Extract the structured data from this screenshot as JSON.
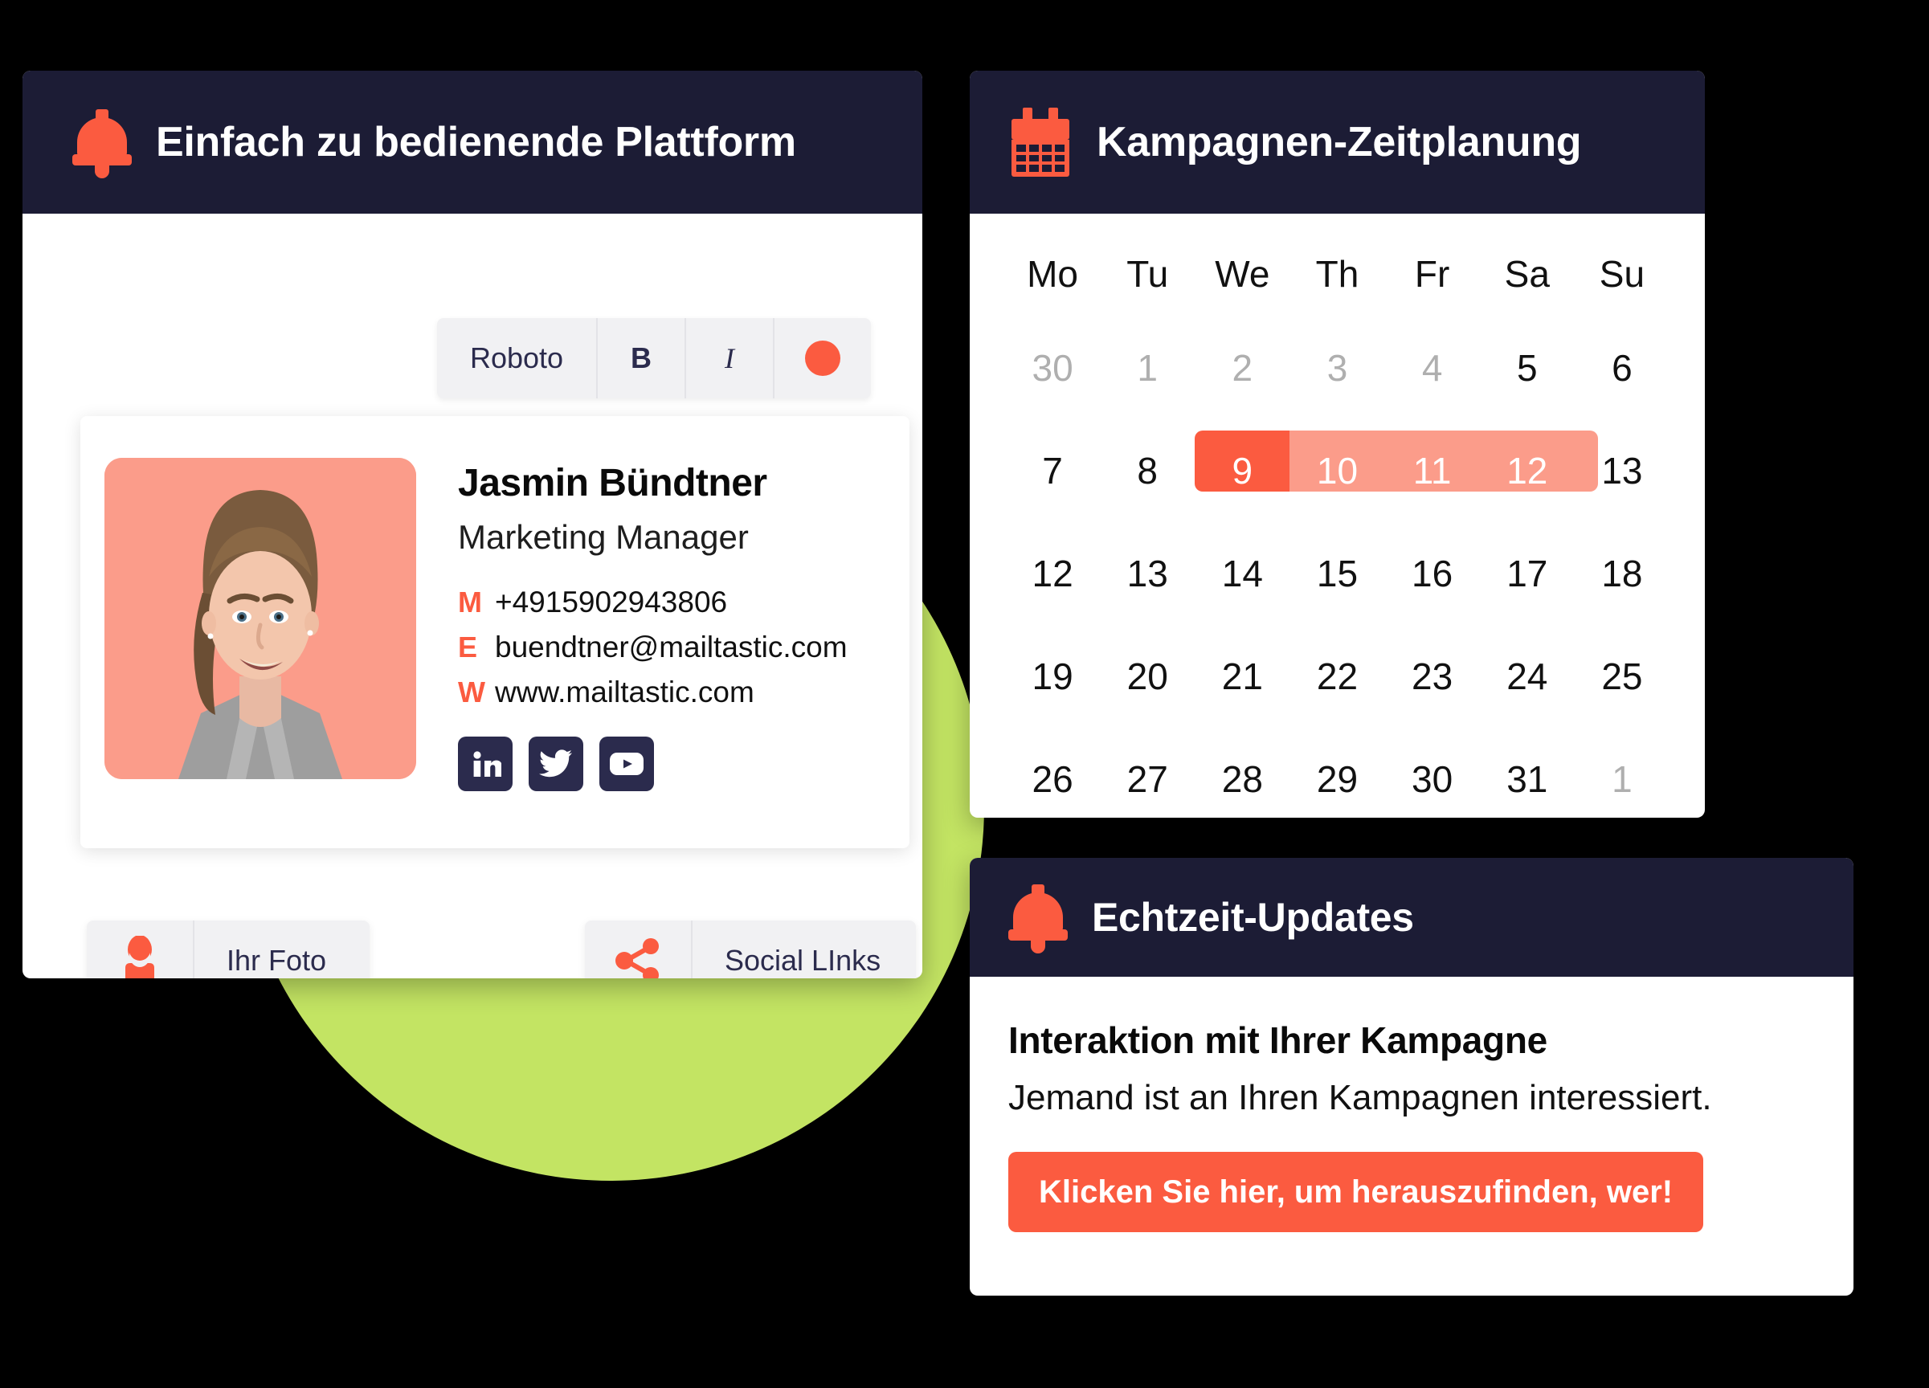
{
  "colors": {
    "accent": "#FB5B40",
    "accent_light": "#FB9C8A",
    "dark": "#1C1C35",
    "green": "#C3E463",
    "ink": "#2B2B4D"
  },
  "platform_card": {
    "title": "Einfach zu bedienende Plattform",
    "icon": "bell-icon",
    "toolbar": {
      "font_name": "Roboto",
      "bold_label": "B",
      "italic_label": "I",
      "color_swatch": "#FB5B40"
    },
    "signature": {
      "name": "Jasmin Bündtner",
      "role": "Marketing Manager",
      "contacts": [
        {
          "key": "M",
          "value": "+4915902943806"
        },
        {
          "key": "E",
          "value": "buendtner@mailtastic.com"
        },
        {
          "key": "W",
          "value": "www.mailtastic.com"
        }
      ],
      "socials": [
        "linkedin-icon",
        "twitter-icon",
        "youtube-icon"
      ]
    },
    "actions": [
      {
        "icon": "person-icon",
        "label": "Ihr Foto"
      },
      {
        "icon": "share-icon",
        "label": "Social LInks"
      }
    ]
  },
  "calendar_card": {
    "title": "Kampagnen-Zeitplanung",
    "icon": "calendar-icon",
    "day_names": [
      "Mo",
      "Tu",
      "We",
      "Th",
      "Fr",
      "Sa",
      "Su"
    ],
    "weeks": [
      [
        {
          "d": "30",
          "state": "muted"
        },
        {
          "d": "1",
          "state": "muted"
        },
        {
          "d": "2",
          "state": "muted"
        },
        {
          "d": "3",
          "state": "muted"
        },
        {
          "d": "4",
          "state": "muted"
        },
        {
          "d": "5",
          "state": "normal"
        },
        {
          "d": "6",
          "state": "normal"
        }
      ],
      [
        {
          "d": "7",
          "state": "normal"
        },
        {
          "d": "8",
          "state": "normal"
        },
        {
          "d": "9",
          "state": "sel-start"
        },
        {
          "d": "10",
          "state": "sel"
        },
        {
          "d": "11",
          "state": "sel"
        },
        {
          "d": "12",
          "state": "sel"
        },
        {
          "d": "13",
          "state": "normal"
        }
      ],
      [
        {
          "d": "12",
          "state": "normal"
        },
        {
          "d": "13",
          "state": "normal"
        },
        {
          "d": "14",
          "state": "normal"
        },
        {
          "d": "15",
          "state": "normal"
        },
        {
          "d": "16",
          "state": "normal"
        },
        {
          "d": "17",
          "state": "normal"
        },
        {
          "d": "18",
          "state": "normal"
        }
      ],
      [
        {
          "d": "19",
          "state": "normal"
        },
        {
          "d": "20",
          "state": "normal"
        },
        {
          "d": "21",
          "state": "normal"
        },
        {
          "d": "22",
          "state": "normal"
        },
        {
          "d": "23",
          "state": "normal"
        },
        {
          "d": "24",
          "state": "normal"
        },
        {
          "d": "25",
          "state": "normal"
        }
      ],
      [
        {
          "d": "26",
          "state": "normal"
        },
        {
          "d": "27",
          "state": "normal"
        },
        {
          "d": "28",
          "state": "normal"
        },
        {
          "d": "29",
          "state": "normal"
        },
        {
          "d": "30",
          "state": "normal"
        },
        {
          "d": "31",
          "state": "normal"
        },
        {
          "d": "1",
          "state": "muted"
        }
      ]
    ]
  },
  "updates_card": {
    "title": "Echtzeit-Updates",
    "icon": "bell-icon",
    "headline": "Interaktion mit Ihrer Kampagne",
    "subline": "Jemand ist an Ihren Kampagnen interessiert.",
    "cta_label": "Klicken Sie hier, um herauszufinden, wer!"
  }
}
